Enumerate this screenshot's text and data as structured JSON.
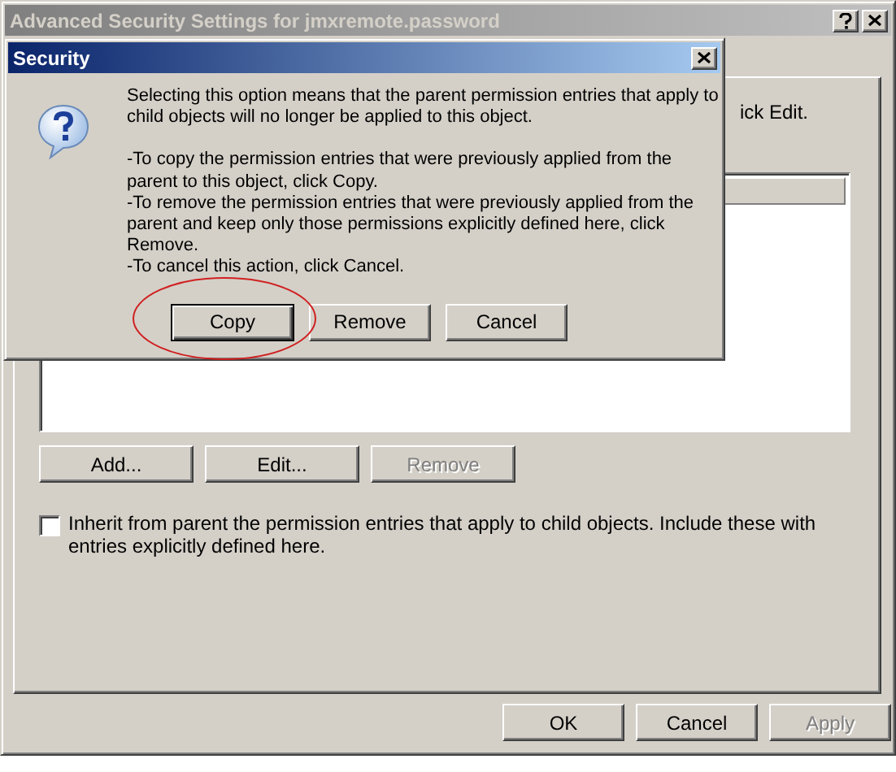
{
  "window": {
    "title": "Advanced Security Settings for jmxremote.password",
    "active": false
  },
  "panel": {
    "partial_text": "ick Edit.",
    "buttons": [
      {
        "label": "Add...",
        "disabled": false
      },
      {
        "label": "Edit...",
        "disabled": false
      },
      {
        "label": "Remove",
        "disabled": true
      }
    ],
    "inherit_checkbox": {
      "label": "Inherit from parent the permission entries that apply to child objects. Include these with entries explicitly defined here.",
      "checked": false
    }
  },
  "footer_buttons": [
    {
      "label": "OK",
      "disabled": false
    },
    {
      "label": "Cancel",
      "disabled": false
    },
    {
      "label": "Apply",
      "disabled": true
    }
  ],
  "dialog": {
    "title": "Security",
    "active": true,
    "paragraphs": [
      "Selecting this option means that the parent permission entries that apply to child objects will no longer be applied to this object.",
      "-To copy  the permission entries that were previously applied from the parent to this object, click Copy.",
      "-To remove the permission entries that were previously applied from the parent and keep only those permissions explicitly defined here, click Remove.",
      "-To cancel this action, click Cancel."
    ],
    "buttons": [
      {
        "label": "Copy",
        "default": true,
        "circled": true
      },
      {
        "label": "Remove",
        "default": false,
        "circled": false
      },
      {
        "label": "Cancel",
        "default": false,
        "circled": false
      }
    ]
  }
}
